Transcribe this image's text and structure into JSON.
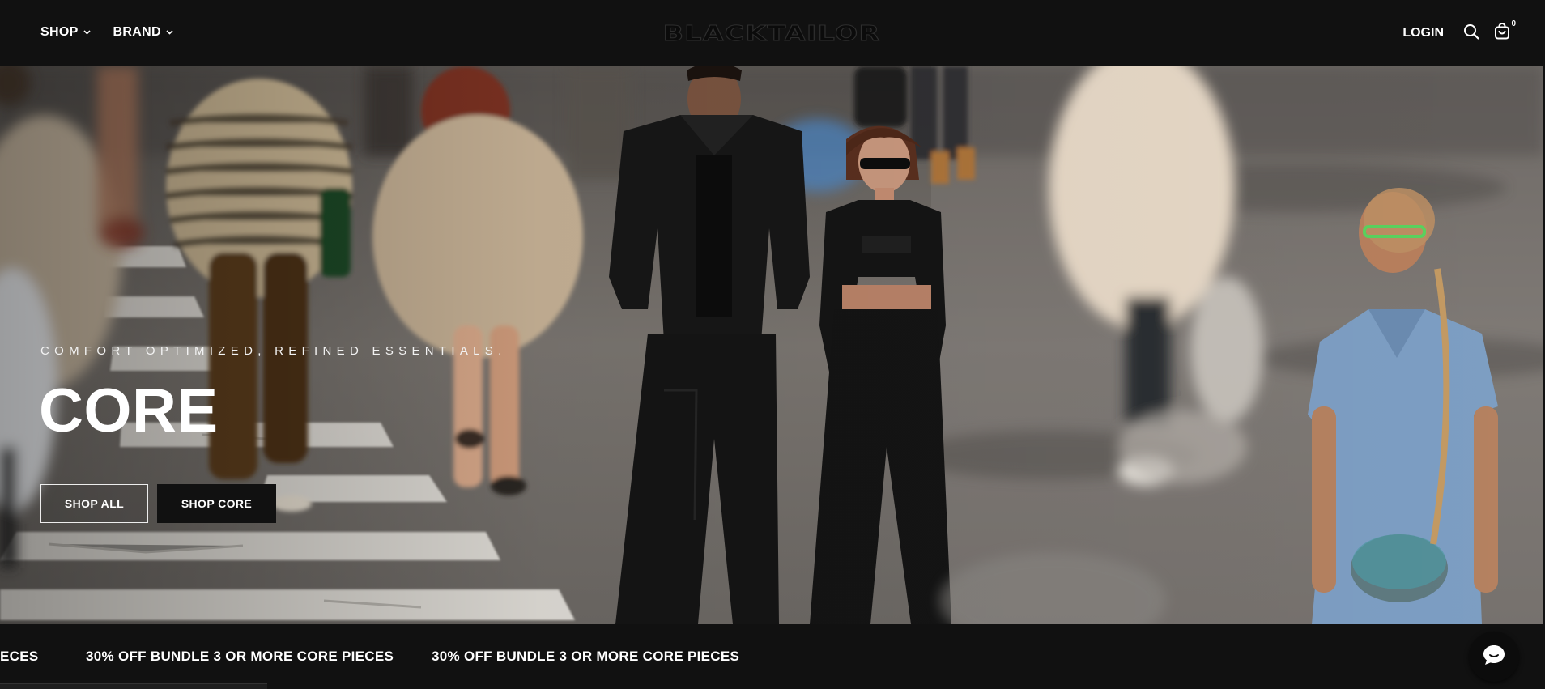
{
  "header": {
    "nav": [
      {
        "label": "SHOP"
      },
      {
        "label": "BRAND"
      }
    ],
    "logo_text": "BLACKTAILOR",
    "login_label": "LOGIN",
    "cart_count": "0",
    "icons": [
      "chevron-down-icon",
      "search-icon",
      "shopping-bag-icon"
    ]
  },
  "hero": {
    "subtitle": "COMFORT OPTIMIZED, REFINED ESSENTIALS.",
    "title": "CORE",
    "buttons": {
      "shop_all": "SHOP ALL",
      "shop_core": "SHOP CORE"
    }
  },
  "marquee": {
    "items": [
      "ECES",
      "30% OFF BUNDLE 3 OR MORE CORE PIECES",
      "30% OFF BUNDLE 3 OR MORE CORE PIECES"
    ]
  },
  "chat": {
    "icon": "chat-icon"
  },
  "colors": {
    "header_bg": "#111111",
    "text": "#ffffff",
    "button_solid_bg": "#111111"
  }
}
